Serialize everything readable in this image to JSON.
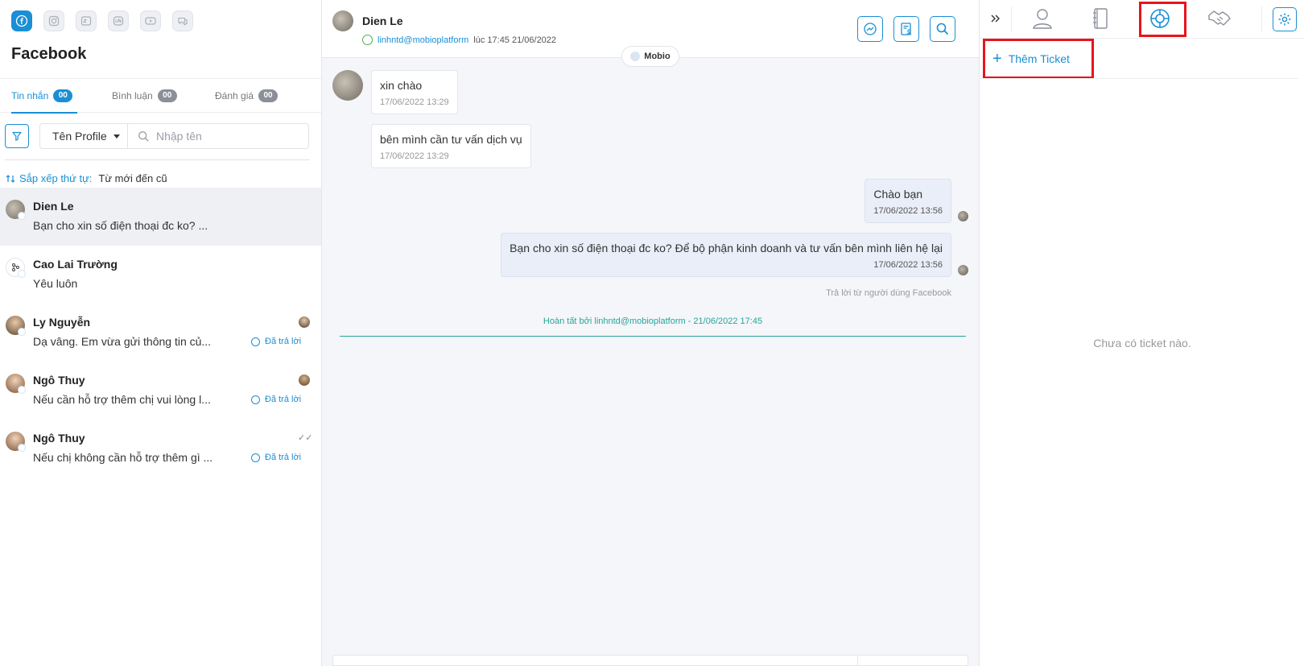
{
  "left": {
    "title": "Facebook",
    "channels": [
      "facebook-icon",
      "instagram-icon",
      "zalo-icon",
      "line-icon",
      "youtube-icon",
      "chat-icon"
    ],
    "tabs": [
      {
        "label": "Tin nhắn",
        "count": "00"
      },
      {
        "label": "Bình luận",
        "count": "00"
      },
      {
        "label": "Đánh giá",
        "count": "00"
      }
    ],
    "profile_select": "Tên Profile",
    "search_placeholder": "Nhập tên",
    "sort_label": "Sắp xếp thứ tự:",
    "sort_value": "Từ mới đến cũ",
    "conversations": [
      {
        "name": "Dien Le",
        "preview": "Bạn cho xin số điện thoại đc ko? ...",
        "replied": ""
      },
      {
        "name": "Cao Lai Trường",
        "preview": "Yêu luôn",
        "replied": ""
      },
      {
        "name": "Ly Nguyễn",
        "preview": "Dạ vâng. Em vừa gửi thông tin củ...",
        "replied": "Đã trả lời"
      },
      {
        "name": "Ngô Thuy",
        "preview": "Nếu cần hỗ trợ thêm chị vui lòng l...",
        "replied": "Đã trả lời"
      },
      {
        "name": "Ngô Thuy",
        "preview": "Nếu chị không cần hỗ trợ thêm gì ...",
        "replied": "Đã trả lời"
      }
    ]
  },
  "chat": {
    "contact_name": "Dien Le",
    "assigned_email": "linhntd@mobioplatform",
    "assigned_time": "lúc 17:45 21/06/2022",
    "source_pill": "Mobio",
    "messages": [
      {
        "text": "xin chào",
        "time": "17/06/2022 13:29"
      },
      {
        "text": "bên mình cần tư vấn dịch vụ",
        "time": "17/06/2022 13:29"
      },
      {
        "text": "Chào bạn",
        "time": "17/06/2022 13:56"
      },
      {
        "text": "Bạn cho xin số điện thoại đc ko? Để bộ phận kinh doanh và tư vấn bên mình liên hệ lại",
        "time": "17/06/2022 13:56"
      }
    ],
    "reply_note": "Trả lời từ người dùng Facebook",
    "completed_note": "Hoàn tất bởi linhntd@mobioplatform - 21/06/2022 17:45"
  },
  "right": {
    "tabs": [
      "collapse-icon",
      "profile-icon",
      "notebook-icon",
      "ticket-icon",
      "deal-icon",
      "settings-icon"
    ],
    "active_tab": "ticket-icon",
    "add_ticket_label": "Thêm Ticket",
    "empty_text": "Chưa có ticket nào."
  },
  "colors": {
    "accent": "#1a8fd6",
    "highlight": "#e8141c",
    "done": "#26a69a"
  }
}
